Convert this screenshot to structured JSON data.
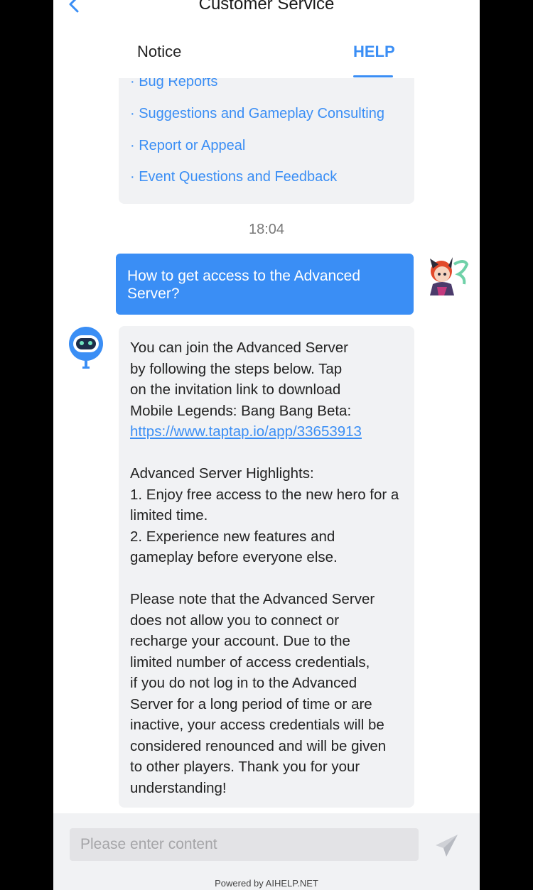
{
  "header": {
    "title": "Customer Service",
    "tabs": [
      {
        "label": "Notice",
        "active": false
      },
      {
        "label": "HELP",
        "active": true
      }
    ]
  },
  "faq_links": [
    "· Bug Reports",
    "· Suggestions and Gameplay Consulting",
    "· Report or Appeal",
    "· Event Questions and Feedback"
  ],
  "timestamp": "18:04",
  "user_message": "How to get access to the Advanced Server?",
  "bot_message": {
    "intro_lines": [
      "You can join the Advanced Server",
      "by following the steps below. Tap",
      "on the invitation link to download",
      "Mobile Legends: Bang Bang Beta:"
    ],
    "link": "https://www.taptap.io/app/33653913",
    "highlights_title": "Advanced Server Highlights:",
    "highlights": [
      "1. Enjoy free access to the new hero for a",
      "limited time.",
      "2. Experience new features and",
      "gameplay before everyone else."
    ],
    "note_lines": [
      "Please note that the Advanced Server",
      "does not allow you to connect or",
      "recharge your account. Due to the",
      "limited number of access credentials,",
      "if you do not log in to the Advanced",
      "Server for a long period of time or are",
      "inactive, your access credentials will be",
      "considered renounced and will be given",
      "to other players. Thank you for your",
      "understanding!"
    ]
  },
  "input": {
    "placeholder": "Please enter content",
    "value": ""
  },
  "powered_by": "Powered by AIHELP.NET",
  "colors": {
    "accent": "#3a8ef5",
    "bubble_gray": "#f1f2f4",
    "background": "#000000"
  },
  "icons": {
    "back": "chevron-left-icon",
    "send": "send-icon",
    "bot": "robot-avatar-icon",
    "user": "user-avatar-icon"
  }
}
